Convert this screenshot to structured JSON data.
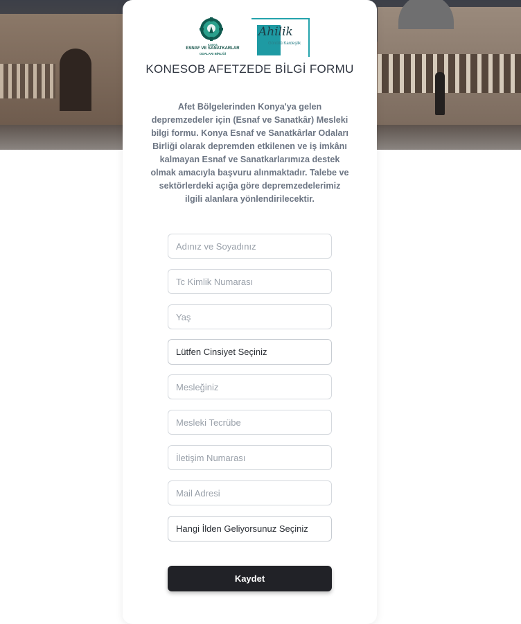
{
  "logos": {
    "konesob": {
      "line1": "KONYA",
      "line2": "ESNAF VE SANATKARLAR",
      "line3": "ODALARI BİRLİĞİ"
    },
    "ahilik": {
      "word": "Ahilik",
      "tagline": "Gönüllü Kardeşlik"
    }
  },
  "form": {
    "title": "KONESOB AFETZEDE BİLGİ FORMU",
    "description": "Afet Bölgelerinden Konya'ya gelen depremzedeler için (Esnaf ve Sanatkâr) Mesleki bilgi formu. Konya Esnaf ve Sanatkârlar Odaları Birliği olarak depremden etkilenen ve iş imkânı kalmayan Esnaf ve Sanatkarlarımıza destek olmak amacıyla başvuru alınmaktadır. Talebe ve sektörlerdeki açığa göre depremzedelerimiz ilgili alanlara yönlendirilecektir.",
    "fields": {
      "name_placeholder": "Adınız ve Soyadınız",
      "tc_placeholder": "Tc Kimlik Numarası",
      "age_placeholder": "Yaş",
      "gender_select": "Lütfen Cinsiyet Seçiniz",
      "profession_placeholder": "Mesleğiniz",
      "experience_placeholder": "Mesleki Tecrübe",
      "phone_placeholder": "İletişim Numarası",
      "email_placeholder": "Mail Adresi",
      "city_select": "Hangi İlden Geliyorsunuz Seçiniz"
    },
    "submit_label": "Kaydet"
  },
  "colors": {
    "brand_dark": "#212227",
    "logo_green": "#0f4f45",
    "logo_teal": "#24a3ac",
    "title_text": "#2f3540",
    "description_text": "#6c7583"
  }
}
